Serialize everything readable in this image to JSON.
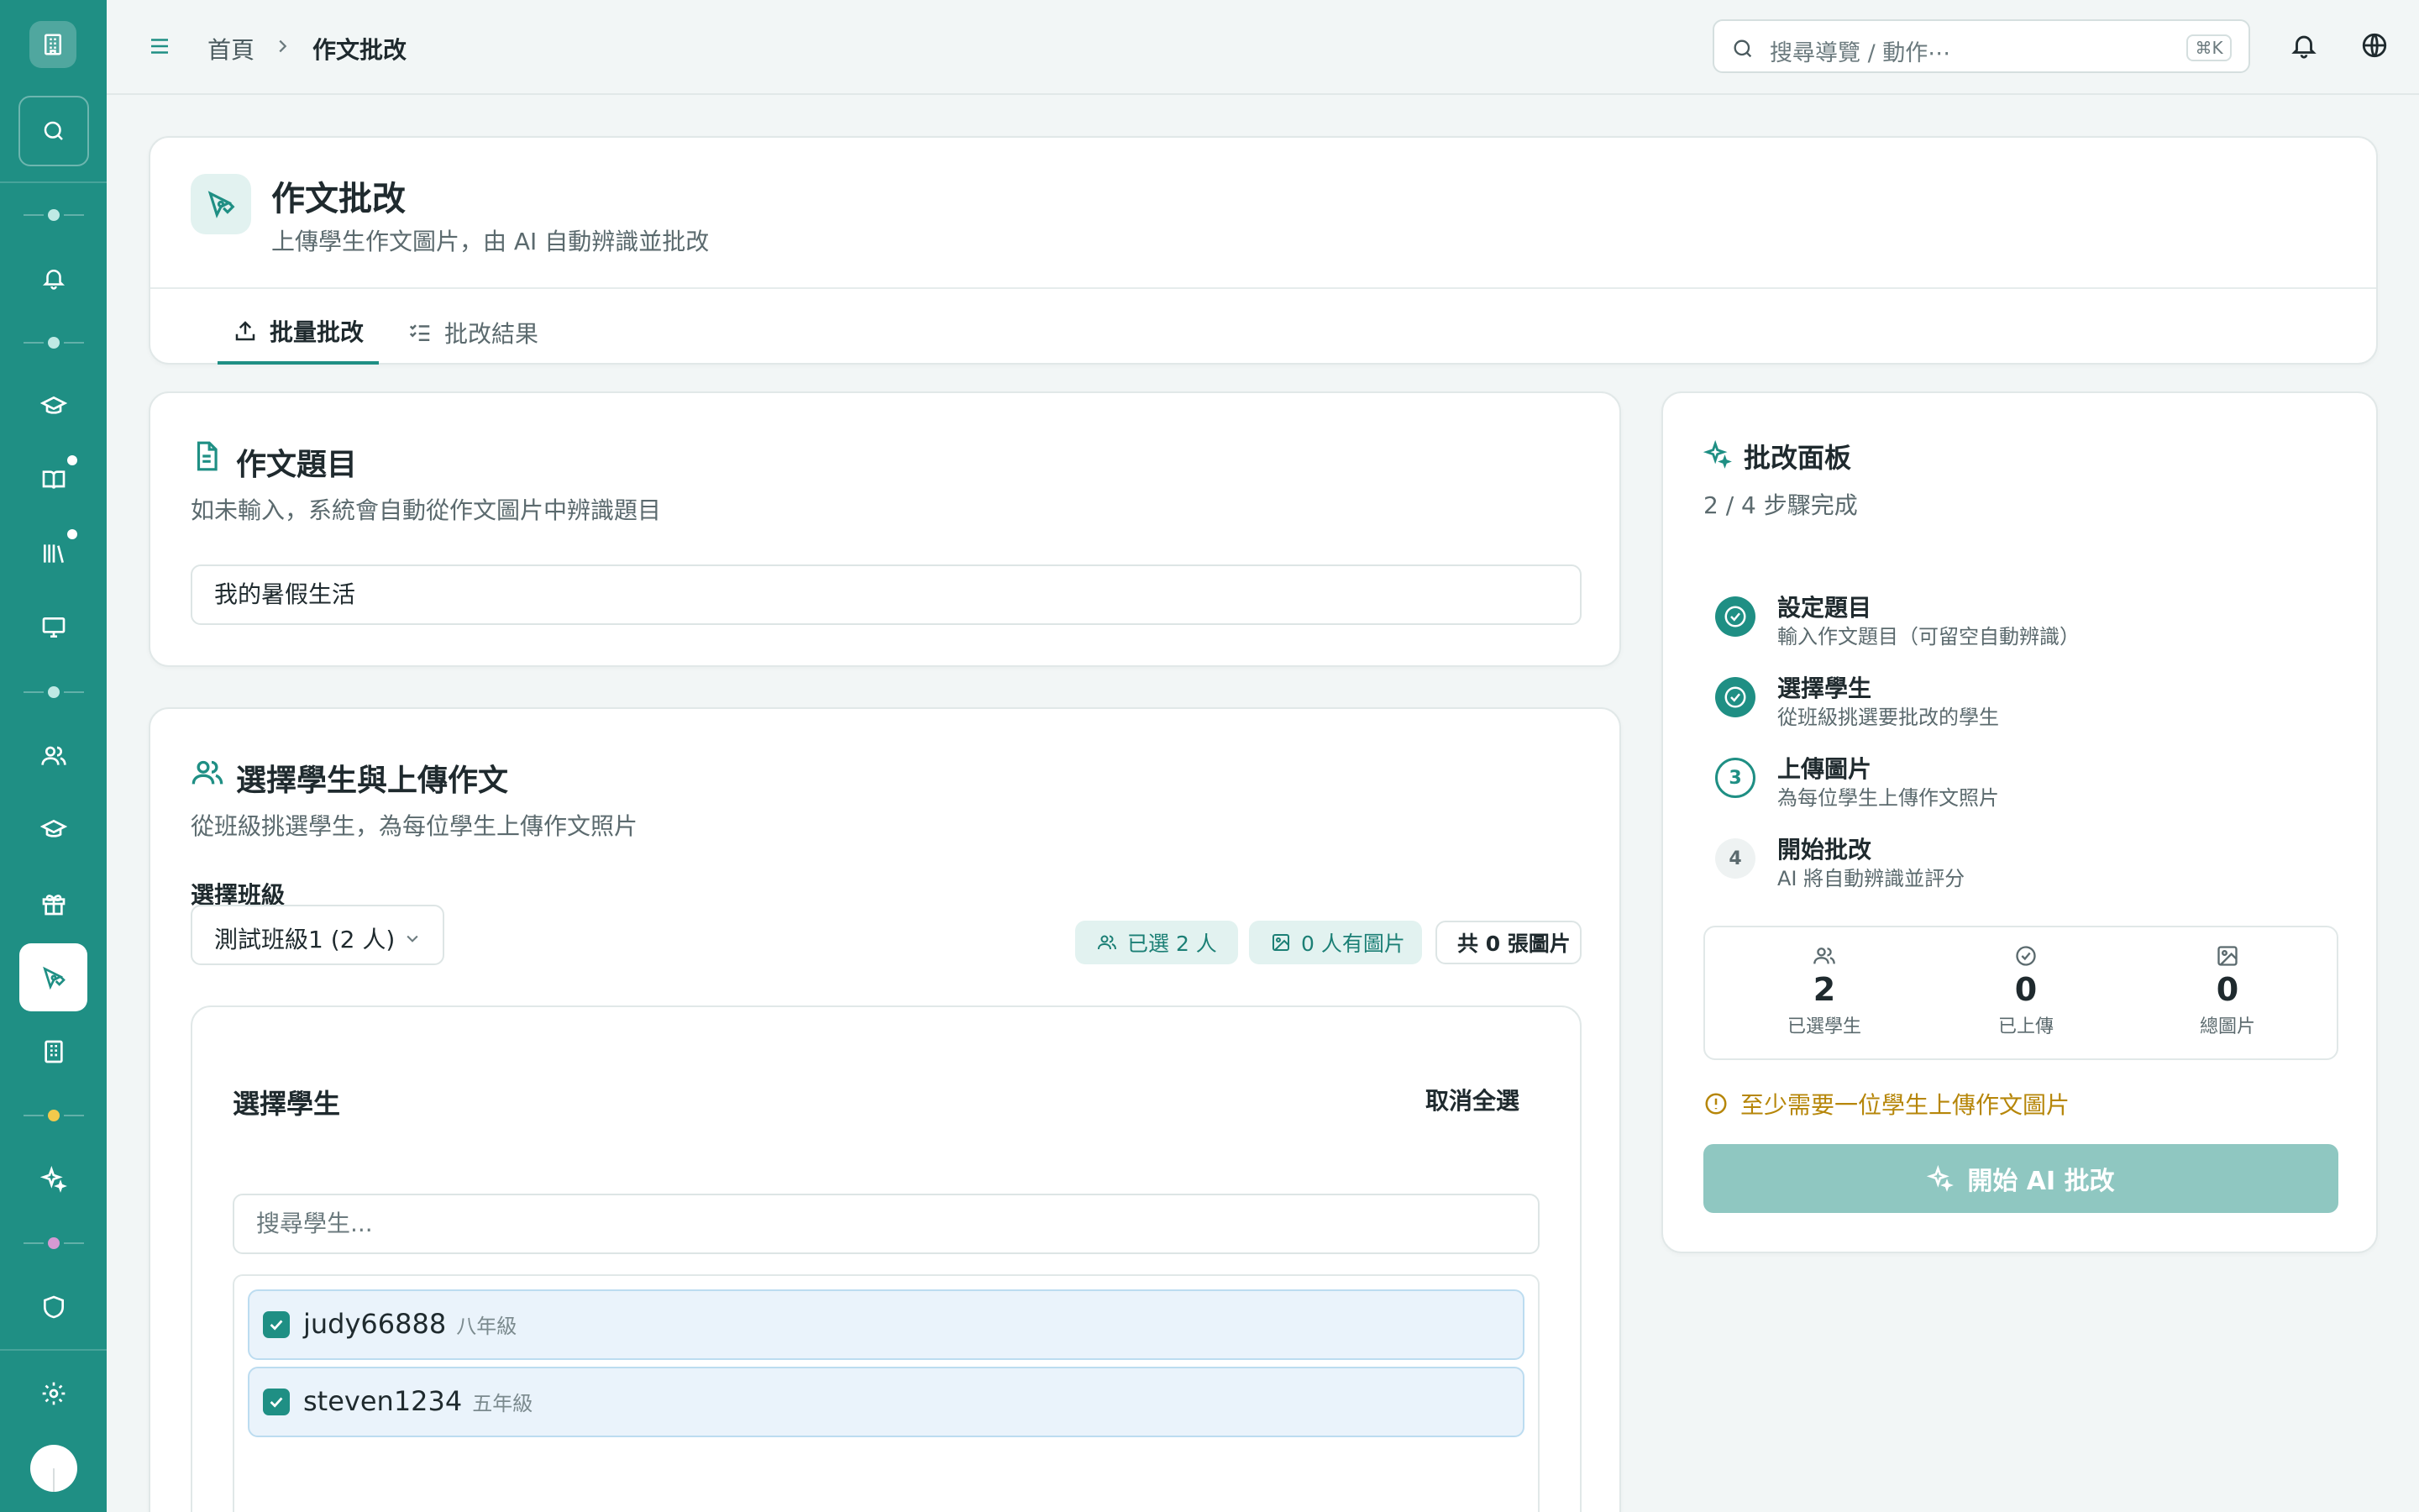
{
  "breadcrumb": {
    "home": "首頁",
    "current": "作文批改"
  },
  "search": {
    "placeholder": "搜尋導覽 / 動作⋯",
    "shortcut": "⌘K"
  },
  "header": {
    "title": "作文批改",
    "subtitle": "上傳學生作文圖片，由 AI 自動辨識並批改",
    "tabs": [
      {
        "label": "批量批改",
        "active": true
      },
      {
        "label": "批改結果",
        "active": false
      }
    ]
  },
  "topic": {
    "title": "作文題目",
    "subtitle": "如未輸入，系統會自動從作文圖片中辨識題目",
    "value": "我的暑假生活"
  },
  "students_section": {
    "title": "選擇學生與上傳作文",
    "subtitle": "從班級挑選學生，為每位學生上傳作文照片",
    "class_label": "選擇班級",
    "class_value": "測試班級1 (2 人)",
    "pills": {
      "selected": "已選 2 人",
      "with_images": "0 人有圖片",
      "total_images": "共 0 張圖片"
    },
    "box_title": "選擇學生",
    "deselect_all": "取消全選",
    "search_placeholder": "搜尋學生...",
    "students": [
      {
        "name": "judy66888",
        "grade": "八年級",
        "checked": true
      },
      {
        "name": "steven1234",
        "grade": "五年級",
        "checked": true
      }
    ]
  },
  "panel": {
    "title": "批改面板",
    "progress": "2 / 4 步驟完成",
    "steps": [
      {
        "number": "1",
        "name": "設定題目",
        "desc": "輸入作文題目（可留空自動辨識）",
        "status": "done"
      },
      {
        "number": "2",
        "name": "選擇學生",
        "desc": "從班級挑選要批改的學生",
        "status": "done"
      },
      {
        "number": "3",
        "name": "上傳圖片",
        "desc": "為每位學生上傳作文照片",
        "status": "current"
      },
      {
        "number": "4",
        "name": "開始批改",
        "desc": "AI 將自動辨識並評分",
        "status": "pending"
      }
    ],
    "stats": [
      {
        "value": "2",
        "label": "已選學生",
        "icon": "users-icon"
      },
      {
        "value": "0",
        "label": "已上傳",
        "icon": "check-circle-icon"
      },
      {
        "value": "0",
        "label": "總圖片",
        "icon": "image-icon"
      }
    ],
    "warning": "至少需要一位學生上傳作文圖片",
    "start_button": "開始 AI 批改"
  },
  "colors": {
    "accent": "#1f8f84",
    "sidebar": "#1f8f84",
    "warning": "#b68609",
    "disabled_button": "#8fc7c1"
  }
}
